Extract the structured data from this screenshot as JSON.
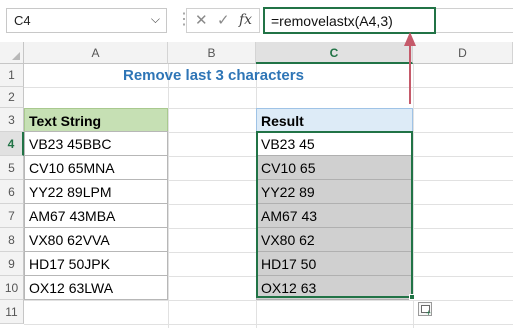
{
  "name_box": {
    "value": "C4"
  },
  "formula_bar": {
    "cancel_glyph": "✕",
    "enter_glyph": "✓",
    "fx_label": "fx",
    "formula": "=removelastx(A4,3)"
  },
  "columns": [
    "A",
    "B",
    "C",
    "D"
  ],
  "rows": [
    "1",
    "2",
    "3",
    "4",
    "5",
    "6",
    "7",
    "8",
    "9",
    "10",
    "11"
  ],
  "selected_column": "C",
  "selected_row": "4",
  "title": "Remove last 3 characters",
  "table_a": {
    "header": "Text String",
    "values": [
      "VB23 45BBC",
      "CV10 65MNA",
      "YY22 89LPM",
      "AM67 43MBA",
      "VX80 62VVA",
      "HD17 50JPK",
      "OX12 63LWA"
    ]
  },
  "table_c": {
    "header": "Result",
    "values": [
      "VB23 45",
      "CV10 65",
      "YY22 89",
      "AM67 43",
      "VX80 62",
      "HD17 50",
      "OX12 63"
    ]
  },
  "colors": {
    "accent": "#217346",
    "title": "#2e75b6",
    "header_a_fill": "#c6e0b4",
    "header_c_fill": "#ddebf7",
    "result_fill": "#d0d0d0",
    "arrow": "#c55a6a"
  },
  "icons": [
    "chevron-down-icon",
    "cancel-icon",
    "enter-icon",
    "fx-icon",
    "quick-analysis-icon",
    "arrow-up-icon"
  ]
}
